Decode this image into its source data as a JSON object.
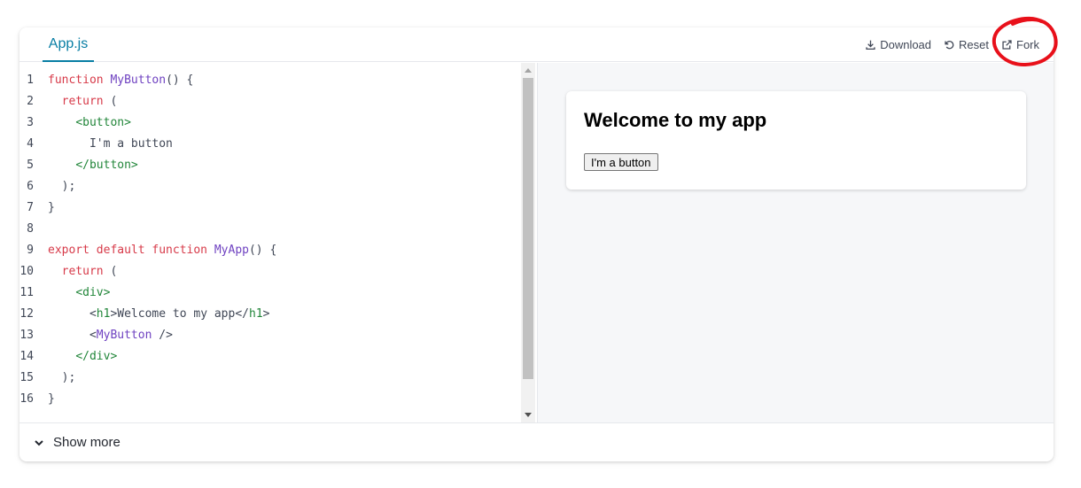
{
  "header": {
    "tab_label": "App.js",
    "actions": {
      "download": "Download",
      "reset": "Reset",
      "fork": "Fork"
    }
  },
  "editor": {
    "line_numbers": [
      "1",
      "2",
      "3",
      "4",
      "5",
      "6",
      "7",
      "8",
      "9",
      "10",
      "11",
      "12",
      "13",
      "14",
      "15",
      "16"
    ],
    "lines": [
      [
        [
          "kw",
          "function "
        ],
        [
          "fn",
          "MyButton"
        ],
        [
          "pl",
          "() {"
        ]
      ],
      [
        [
          "kw",
          "  return "
        ],
        [
          "pl",
          "("
        ]
      ],
      [
        [
          "pl",
          "    "
        ],
        [
          "tag",
          "<button>"
        ]
      ],
      [
        [
          "pl",
          "      I'm a button"
        ]
      ],
      [
        [
          "pl",
          "    "
        ],
        [
          "tag",
          "</button>"
        ]
      ],
      [
        [
          "pl",
          "  );"
        ]
      ],
      [
        [
          "pl",
          "}"
        ]
      ],
      [
        [
          "pl",
          ""
        ]
      ],
      [
        [
          "kw",
          "export default function "
        ],
        [
          "fn",
          "MyApp"
        ],
        [
          "pl",
          "() {"
        ]
      ],
      [
        [
          "kw",
          "  return "
        ],
        [
          "pl",
          "("
        ]
      ],
      [
        [
          "pl",
          "    "
        ],
        [
          "tag",
          "<div>"
        ]
      ],
      [
        [
          "pl",
          "      <"
        ],
        [
          "tag",
          "h1"
        ],
        [
          "pl",
          ">Welcome to my app</"
        ],
        [
          "tag",
          "h1"
        ],
        [
          "pl",
          ">"
        ]
      ],
      [
        [
          "pl",
          "      <"
        ],
        [
          "fn",
          "MyButton"
        ],
        [
          "pl",
          " />"
        ]
      ],
      [
        [
          "pl",
          "    "
        ],
        [
          "tag",
          "</div>"
        ]
      ],
      [
        [
          "pl",
          "  );"
        ]
      ],
      [
        [
          "pl",
          "}"
        ]
      ]
    ]
  },
  "preview": {
    "heading": "Welcome to my app",
    "button_label": "I'm a button"
  },
  "footer": {
    "show_more_label": "Show more"
  },
  "colors": {
    "accent": "#087ea4",
    "annotation": "#e8101a",
    "keyword": "#d73a49",
    "function": "#6f42c1",
    "tag": "#22863a"
  }
}
